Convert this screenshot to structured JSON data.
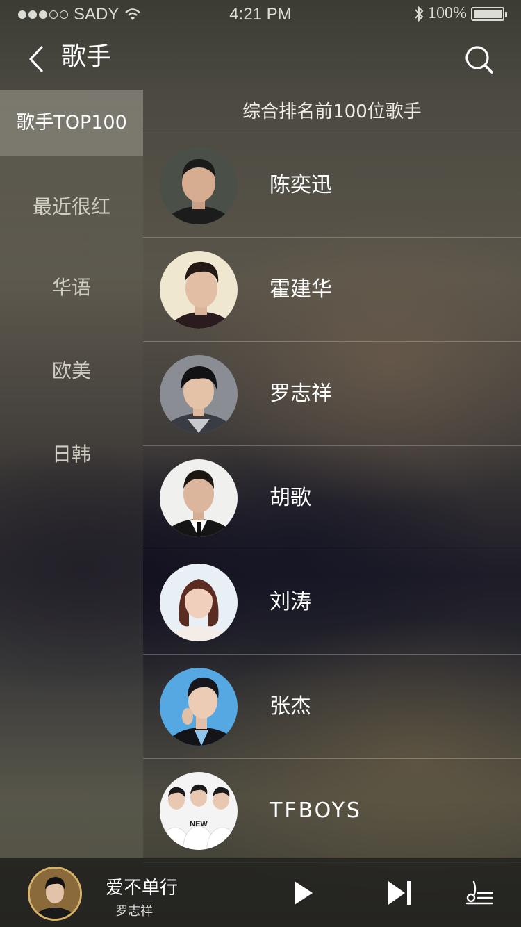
{
  "status_bar": {
    "carrier": "SADY",
    "time": "4:21 PM",
    "battery": "100%"
  },
  "nav": {
    "title": "歌手"
  },
  "sidebar": {
    "items": [
      {
        "label": "歌手TOP100",
        "active": true
      },
      {
        "label": "最近很红",
        "active": false
      },
      {
        "label": "华语",
        "active": false
      },
      {
        "label": "欧美",
        "active": false
      },
      {
        "label": "日韩",
        "active": false
      }
    ]
  },
  "list": {
    "header": "综合排名前100位歌手",
    "singers": [
      {
        "name": "陈奕迅",
        "avatar_bg": "#4a5048"
      },
      {
        "name": "霍建华",
        "avatar_bg": "#efe7cf"
      },
      {
        "name": "罗志祥",
        "avatar_bg": "#8a8e94"
      },
      {
        "name": "胡歌",
        "avatar_bg": "#f0f0ee"
      },
      {
        "name": "刘涛",
        "avatar_bg": "#e8f0f6"
      },
      {
        "name": "张杰",
        "avatar_bg": "#56a8e2"
      },
      {
        "name": "TFBOYS",
        "avatar_bg": "#f4f4f4"
      }
    ]
  },
  "player": {
    "song_title": "爱不单行",
    "artist": "罗志祥",
    "accent": "#d9b26a"
  }
}
